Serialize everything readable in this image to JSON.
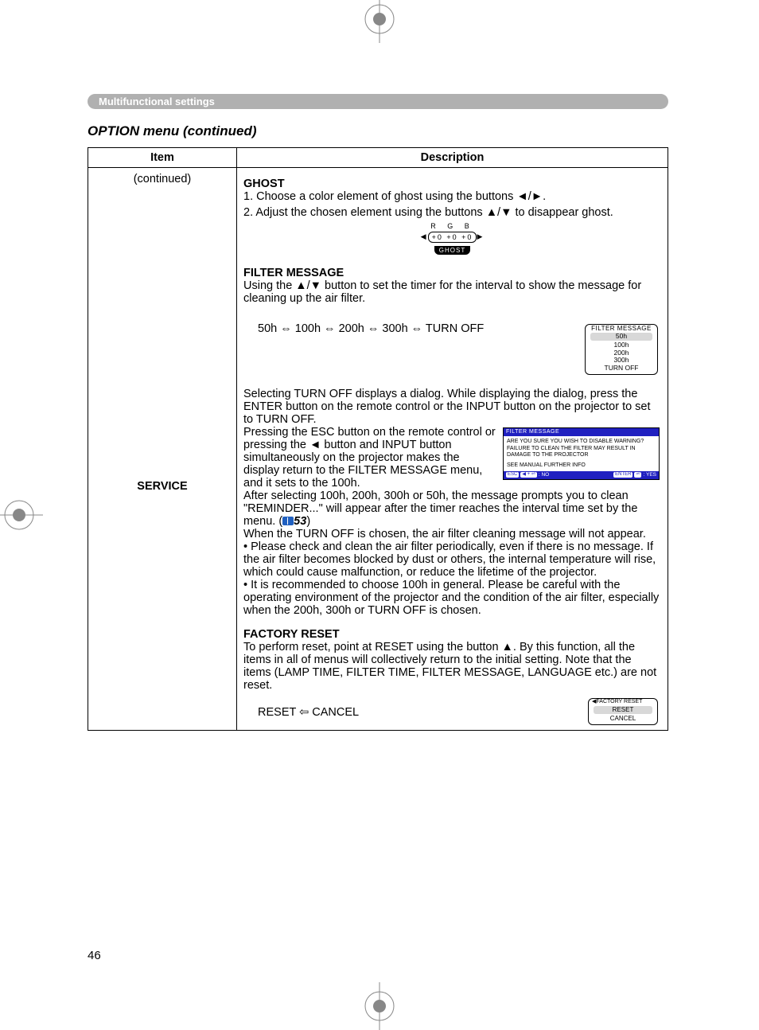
{
  "header": {
    "section_label": "Multifunctional settings",
    "subtitle": "OPTION menu (continued)"
  },
  "table": {
    "headers": {
      "item": "Item",
      "description": "Description"
    },
    "item_continued": "(continued)",
    "service_label": "SERVICE"
  },
  "ghost": {
    "title": "GHOST",
    "step1": "1. Choose a color element of ghost using the buttons ◄/►.",
    "step2": "2. Adjust the chosen element using the buttons ▲/▼ to disappear ghost.",
    "osd": {
      "rgb": "R   G   B",
      "vals": "+0   +0   +0",
      "label": "GHOST"
    }
  },
  "filter_message": {
    "title": "FILTER MESSAGE",
    "intro": "Using the ▲/▼ button to set the timer for the interval to show the message for cleaning up the air filter.",
    "options_line": "50h ⇔ 100h ⇔ 200h ⇔ 300h ⇔ TURN OFF",
    "osd_list": {
      "header": "FILTER MESSAGE",
      "items": [
        "50h",
        "100h",
        "200h",
        "300h",
        "TURN OFF"
      ],
      "selected_index": 0
    },
    "para1": "Selecting TURN OFF displays a dialog. While displaying the dialog, press the ENTER button on the remote control or the INPUT button on the projector to set to TURN OFF.",
    "para2": "Pressing the ESC button on the remote control or pressing the ◄ button and INPUT button simultaneously on the projector makes the display return to the FILTER MESSAGE menu, and it sets to the 100h.",
    "osd_dialog": {
      "title": "FILTER MESSAGE",
      "line1": "ARE YOU SURE YOU WISH TO DISABLE WARNING?",
      "line2": "FAILURE TO CLEAN THE FILTER MAY RESULT IN DAMAGE TO THE PROJECTOR",
      "line3": "SEE MANUAL FURTHER INFO",
      "foot_left_label": "ESC",
      "foot_left_btn": "◀ + ⏎",
      "foot_left_text": ": NO",
      "foot_right_label": "ENTER",
      "foot_right_btn": "⏎",
      "foot_right_text": ": YES"
    },
    "para3_a": "After selecting 100h, 200h, 300h or 50h, the message prompts you to clean \"REMINDER...\" will appear after the timer reaches the interval time set by the menu. (",
    "para3_ref": "53",
    "para3_b": ")",
    "para4": "When the TURN OFF is chosen, the air filter cleaning message will not appear.",
    "bullet1": "• Please check and clean the air filter periodically, even if there is no message. If the air filter becomes blocked by dust or others, the internal temperature will rise, which could cause malfunction, or reduce the lifetime of the projector.",
    "bullet2": "• It is recommended to choose 100h in general. Please be careful with the operating environment of the projector and the condition of the air filter, especially when the 200h, 300h or TURN OFF is chosen."
  },
  "factory_reset": {
    "title": "FACTORY RESET",
    "para": "To perform reset, point at RESET using the button ▲. By this function, all the items in all of menus will collectively return to the initial setting. Note that the items (LAMP TIME, FILTER TIME, FILTER MESSAGE, LANGUAGE etc.) are not reset.",
    "options_line": "RESET ⇦ CANCEL",
    "osd": {
      "header": "FACTORY RESET",
      "items": [
        "RESET",
        "CANCEL"
      ],
      "selected_index": 0
    }
  },
  "page_number": "46"
}
